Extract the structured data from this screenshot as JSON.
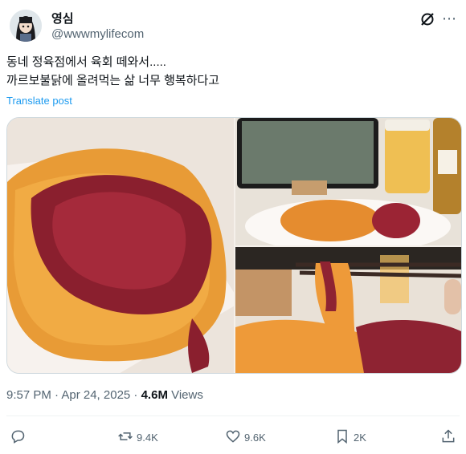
{
  "author": {
    "name": "영심",
    "handle": "@wwwmylifecom"
  },
  "post": {
    "lines": [
      "동네 정육점에서 육회 떼와서.....",
      "까르보불닭에 올려먹는 삶 너무 행복하다고"
    ],
    "translate_label": "Translate post"
  },
  "meta": {
    "time": "9:57 PM · Apr 24, 2025 · ",
    "views_count": "4.6M",
    "views_label": " Views"
  },
  "actions": {
    "reposts": "9.4K",
    "likes": "9.6K",
    "bookmarks": "2K"
  },
  "images": [
    {
      "icons": "food-photo"
    }
  ],
  "colors": {
    "link": "#1d9bf0",
    "secondary": "#536471"
  }
}
